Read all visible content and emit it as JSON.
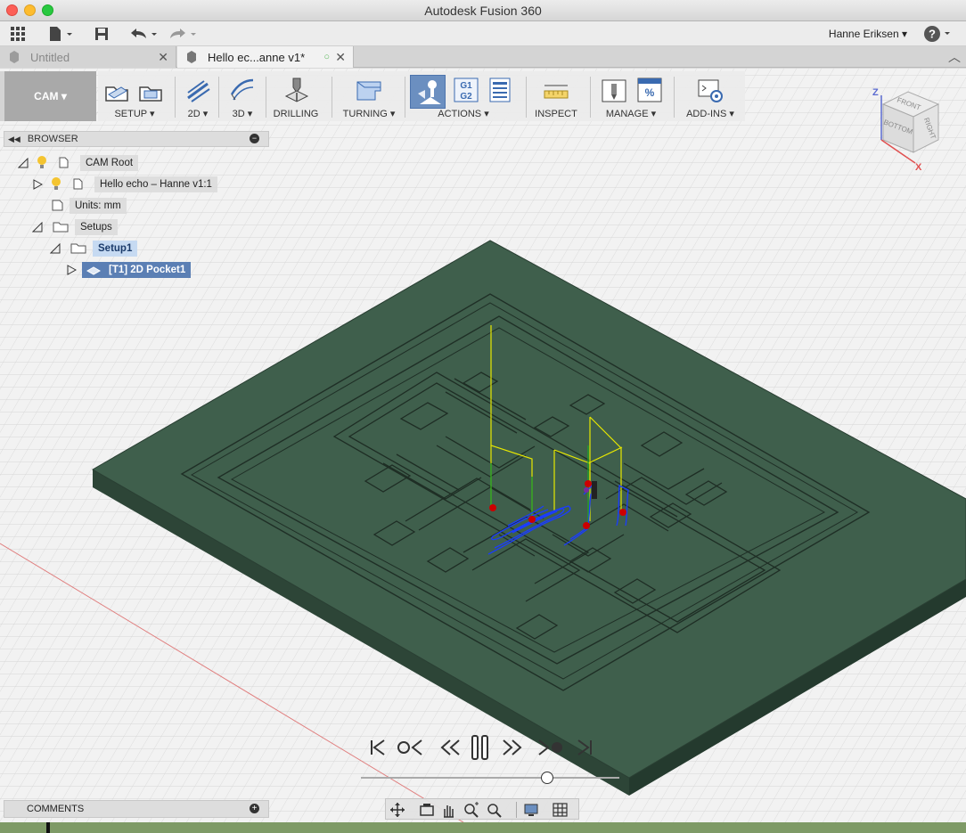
{
  "window": {
    "title": "Autodesk Fusion 360"
  },
  "quick_access": {
    "user_name": "Hanne Eriksen ▾",
    "help": "?"
  },
  "tabs": [
    {
      "label": "Untitled",
      "active": false
    },
    {
      "label": "Hello ec...anne v1*",
      "active": true
    }
  ],
  "ribbon": {
    "workspace": "CAM ▾",
    "groups": [
      {
        "label": "SETUP ▾"
      },
      {
        "label": "2D ▾"
      },
      {
        "label": "3D ▾"
      },
      {
        "label": "DRILLING"
      },
      {
        "label": "TURNING ▾"
      },
      {
        "label": "ACTIONS ▾"
      },
      {
        "label": "INSPECT"
      },
      {
        "label": "MANAGE ▾"
      },
      {
        "label": "ADD-INS ▾"
      }
    ],
    "actions_g_code": {
      "g1": "G1",
      "g2": "G2"
    },
    "manage_percent": "%"
  },
  "browser": {
    "title": "BROWSER",
    "items": [
      {
        "label": "CAM Root"
      },
      {
        "label": "Hello echo – Hanne v1:1"
      },
      {
        "label": "Units: mm"
      },
      {
        "label": "Setups"
      },
      {
        "label": "Setup1"
      },
      {
        "label": "[T1] 2D Pocket1"
      }
    ]
  },
  "viewcube": {
    "front": "FRONT",
    "right": "RIGHT",
    "bottom": "BOTTOM",
    "axis_z": "Z",
    "axis_x": "X"
  },
  "comments": {
    "title": "COMMENTS"
  },
  "colors": {
    "board_top": "#3f5f4c",
    "board_side": "#2d4537",
    "toolpath_blue": "#1a3cff",
    "lead_yellow": "#e8e800",
    "plunge_green": "#22aa22",
    "marker_red": "#cc0000",
    "timeline_green": "#7e9a66"
  }
}
